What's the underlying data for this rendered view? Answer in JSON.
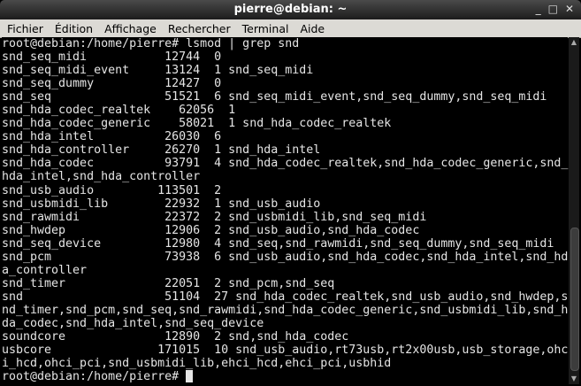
{
  "window": {
    "title": "pierre@debian: ~",
    "minimize": "_",
    "maximize": "□",
    "close": "✕"
  },
  "menu": [
    "Fichier",
    "Édition",
    "Affichage",
    "Rechercher",
    "Terminal",
    "Aide"
  ],
  "terminal": {
    "prompt": "root@debian:/home/pierre# ",
    "command": "lsmod | grep snd",
    "columns": 80,
    "modules": [
      {
        "name": "snd_seq_midi",
        "size": "12744",
        "used": "0",
        "by": ""
      },
      {
        "name": "snd_seq_midi_event",
        "size": "13124",
        "used": "1",
        "by": "snd_seq_midi"
      },
      {
        "name": "snd_seq_dummy",
        "size": "12427",
        "used": "0",
        "by": ""
      },
      {
        "name": "snd_seq",
        "size": "51521",
        "used": "6",
        "by": "snd_seq_midi_event,snd_seq_dummy,snd_seq_midi"
      },
      {
        "name": "snd_hda_codec_realtek",
        "size": "62056",
        "used": "1",
        "by": ""
      },
      {
        "name": "snd_hda_codec_generic",
        "size": "58021",
        "used": "1",
        "by": "snd_hda_codec_realtek"
      },
      {
        "name": "snd_hda_intel",
        "size": "26030",
        "used": "6",
        "by": ""
      },
      {
        "name": "snd_hda_controller",
        "size": "26270",
        "used": "1",
        "by": "snd_hda_intel"
      },
      {
        "name": "snd_hda_codec",
        "size": "93791",
        "used": "4",
        "by": "snd_hda_codec_realtek,snd_hda_codec_generic,snd_hda_intel,snd_hda_controller"
      },
      {
        "name": "snd_usb_audio",
        "size": "113501",
        "used": "2",
        "by": ""
      },
      {
        "name": "snd_usbmidi_lib",
        "size": "22932",
        "used": "1",
        "by": "snd_usb_audio"
      },
      {
        "name": "snd_rawmidi",
        "size": "22372",
        "used": "2",
        "by": "snd_usbmidi_lib,snd_seq_midi"
      },
      {
        "name": "snd_hwdep",
        "size": "12906",
        "used": "2",
        "by": "snd_usb_audio,snd_hda_codec"
      },
      {
        "name": "snd_seq_device",
        "size": "12980",
        "used": "4",
        "by": "snd_seq,snd_rawmidi,snd_seq_dummy,snd_seq_midi"
      },
      {
        "name": "snd_pcm",
        "size": "73938",
        "used": "6",
        "by": "snd_usb_audio,snd_hda_codec,snd_hda_intel,snd_hda_controller"
      },
      {
        "name": "snd_timer",
        "size": "22051",
        "used": "2",
        "by": "snd_pcm,snd_seq"
      },
      {
        "name": "snd",
        "size": "51104",
        "used": "27",
        "by": "snd_hda_codec_realtek,snd_usb_audio,snd_hwdep,snd_timer,snd_pcm,snd_seq,snd_rawmidi,snd_hda_codec_generic,snd_usbmidi_lib,snd_hda_codec,snd_hda_intel,snd_seq_device"
      },
      {
        "name": "soundcore",
        "size": "12890",
        "used": "2",
        "by": "snd,snd_hda_codec"
      },
      {
        "name": "usbcore",
        "size": "171015",
        "used": "10",
        "by": "snd_usb_audio,rt73usb,rt2x00usb,usb_storage,ohci_hcd,ohci_pci,snd_usbmidi_lib,ehci_hcd,ehci_pci,usbhid"
      }
    ]
  }
}
